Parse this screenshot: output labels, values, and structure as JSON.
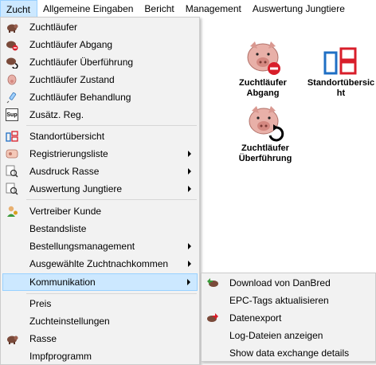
{
  "menubar": {
    "items": [
      {
        "label": "Zucht",
        "active": true
      },
      {
        "label": "Allgemeine Eingaben"
      },
      {
        "label": "Bericht"
      },
      {
        "label": "Management"
      },
      {
        "label": "Auswertung Jungtiere"
      }
    ]
  },
  "desktop": {
    "icons": [
      {
        "label": "Zuchtläufer Abgang",
        "icon": "pig-remove-icon"
      },
      {
        "label": "Standortübersicht",
        "icon": "location-overview-icon"
      },
      {
        "label": "Zuchtläufer Überführung",
        "icon": "pig-transfer-icon"
      }
    ]
  },
  "menu": {
    "items": [
      {
        "label": "Zuchtläufer",
        "icon": "pig-icon"
      },
      {
        "label": "Zuchtläufer Abgang",
        "icon": "pig-remove-icon"
      },
      {
        "label": "Zuchtläufer Überführung",
        "icon": "pig-transfer-icon"
      },
      {
        "label": "Zuchtläufer Zustand",
        "icon": "pig-status-icon"
      },
      {
        "label": "Zuchtläufer Behandlung",
        "icon": "syringe-icon"
      },
      {
        "label": "Zusätz. Reg.",
        "icon": "sup-badge-icon",
        "icon_text": "Sup"
      },
      {
        "label": "Standortübersicht",
        "icon": "location-overview-icon"
      },
      {
        "label": "Registrierungsliste",
        "icon": "registration-list-icon",
        "submenu": true
      },
      {
        "label": "Ausdruck Rasse",
        "icon": "print-search-icon",
        "submenu": true
      },
      {
        "label": "Auswertung Jungtiere",
        "icon": "evaluation-search-icon",
        "submenu": true
      },
      {
        "label": "Vertreiber Kunde",
        "icon": "customer-icon"
      },
      {
        "label": "Bestandsliste"
      },
      {
        "label": "Bestellungsmanagement",
        "submenu": true
      },
      {
        "label": "Ausgewählte Zuchtnachkommen",
        "submenu": true
      },
      {
        "label": "Kommunikation",
        "submenu": true,
        "highlighted": true
      },
      {
        "label": "Preis"
      },
      {
        "label": "Zuchteinstellungen"
      },
      {
        "label": "Rasse",
        "icon": "pig-icon"
      },
      {
        "label": "Impfprogramm"
      }
    ]
  },
  "submenu": {
    "items": [
      {
        "label": "Download von DanBred",
        "icon": "download-pig-icon"
      },
      {
        "label": "EPC-Tags aktualisieren"
      },
      {
        "label": "Datenexport",
        "icon": "export-pig-icon"
      },
      {
        "label": "Log-Dateien anzeigen"
      },
      {
        "label": "Show data exchange details"
      }
    ]
  },
  "colors": {
    "menu_bg": "#f2f2f2",
    "highlight_bg": "#cce8ff",
    "highlight_border": "#99d1ff",
    "pig_pink": "#e8a8a0",
    "remove_red": "#d81e2a",
    "blue_frame": "#1f6fc4"
  }
}
